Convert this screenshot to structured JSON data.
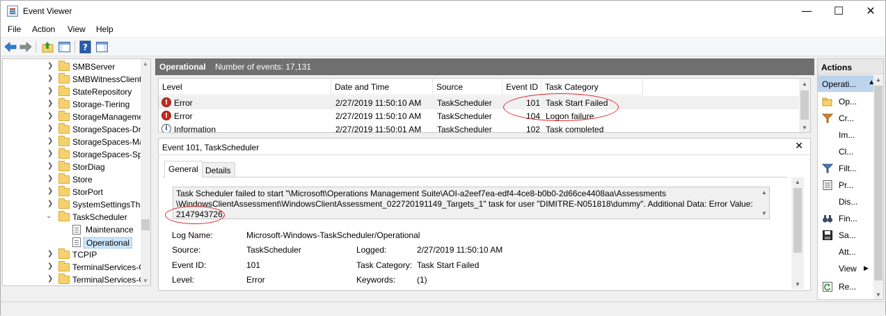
{
  "window": {
    "title": "Event Viewer",
    "minimize": "—",
    "maximize": "☐",
    "close": "✕"
  },
  "menu": {
    "file": "File",
    "action": "Action",
    "view": "View",
    "help": "Help"
  },
  "tree": {
    "items": [
      {
        "label": "SMBServer",
        "type": "folder"
      },
      {
        "label": "SMBWitnessClient",
        "type": "folder"
      },
      {
        "label": "StateRepository",
        "type": "folder"
      },
      {
        "label": "Storage-Tiering",
        "type": "folder"
      },
      {
        "label": "StorageManageme",
        "type": "folder"
      },
      {
        "label": "StorageSpaces-Dri",
        "type": "folder"
      },
      {
        "label": "StorageSpaces-Ma",
        "type": "folder"
      },
      {
        "label": "StorageSpaces-Spa",
        "type": "folder"
      },
      {
        "label": "StorDiag",
        "type": "folder"
      },
      {
        "label": "Store",
        "type": "folder"
      },
      {
        "label": "StorPort",
        "type": "folder"
      },
      {
        "label": "SystemSettingsThr",
        "type": "folder"
      },
      {
        "label": "TaskScheduler",
        "type": "folder-open"
      },
      {
        "label": "Maintenance",
        "type": "log"
      },
      {
        "label": "Operational",
        "type": "log-selected"
      },
      {
        "label": "TCPIP",
        "type": "folder"
      },
      {
        "label": "TerminalServices-C",
        "type": "folder"
      },
      {
        "label": "TerminalServices-C",
        "type": "folder"
      }
    ]
  },
  "header": {
    "title": "Operational",
    "count": "Number of events: 17,131"
  },
  "events": {
    "columns": [
      "Level",
      "Date and Time",
      "Source",
      "Event ID",
      "Task Category"
    ],
    "rows": [
      {
        "level": "Error",
        "icon": "error-icon",
        "date": "2/27/2019 11:50:10 AM",
        "source": "TaskScheduler",
        "id": "101",
        "category": "Task Start Failed"
      },
      {
        "level": "Error",
        "icon": "error-icon",
        "date": "2/27/2019 11:50:10 AM",
        "source": "TaskScheduler",
        "id": "104",
        "category": "Logon failure"
      },
      {
        "level": "Information",
        "icon": "information-icon",
        "date": "2/27/2019 11:50:01 AM",
        "source": "TaskScheduler",
        "id": "102",
        "category": "Task completed"
      }
    ]
  },
  "detail": {
    "title": "Event 101, TaskScheduler",
    "tabs": [
      "General",
      "Details"
    ],
    "message_line1": "Task Scheduler failed to start \"\\Microsoft\\Operations Management Suite\\AOI-a2eef7ea-edf4-4ce8-b0b0-2d66ce4408aa\\Assessments",
    "message_line2": "\\WindowsClientAssessment\\WindowsClientAssessment_022720191149_Targets_1\" task for user \"DIMITRE-N051818\\dummy\". Additional Data: Error Value:",
    "message_line3": "2147943726.",
    "fields": {
      "log_name_label": "Log Name:",
      "log_name": "Microsoft-Windows-TaskScheduler/Operational",
      "source_label": "Source:",
      "source": "TaskScheduler",
      "logged_label": "Logged:",
      "logged": "2/27/2019 11:50:10 AM",
      "event_id_label": "Event ID:",
      "event_id": "101",
      "task_category_label": "Task Category:",
      "task_category": "Task Start Failed",
      "level_label": "Level:",
      "level": "Error",
      "keywords_label": "Keywords:",
      "keywords": "(1)"
    }
  },
  "actions": {
    "title": "Actions",
    "section": "Operati...",
    "items": [
      {
        "label": "Op...",
        "icon": "open-folder-icon"
      },
      {
        "label": "Cr...",
        "icon": "filter-icon"
      },
      {
        "label": "Im...",
        "icon": ""
      },
      {
        "label": "Cl...",
        "icon": ""
      },
      {
        "label": "Filt...",
        "icon": "filter-icon"
      },
      {
        "label": "Pr...",
        "icon": "properties-icon"
      },
      {
        "label": "Dis...",
        "icon": ""
      },
      {
        "label": "Fin...",
        "icon": "binoculars-icon"
      },
      {
        "label": "Sa...",
        "icon": "save-icon"
      },
      {
        "label": "Att...",
        "icon": ""
      },
      {
        "label": "View",
        "icon": ""
      },
      {
        "label": "Re...",
        "icon": "refresh-icon"
      }
    ]
  }
}
